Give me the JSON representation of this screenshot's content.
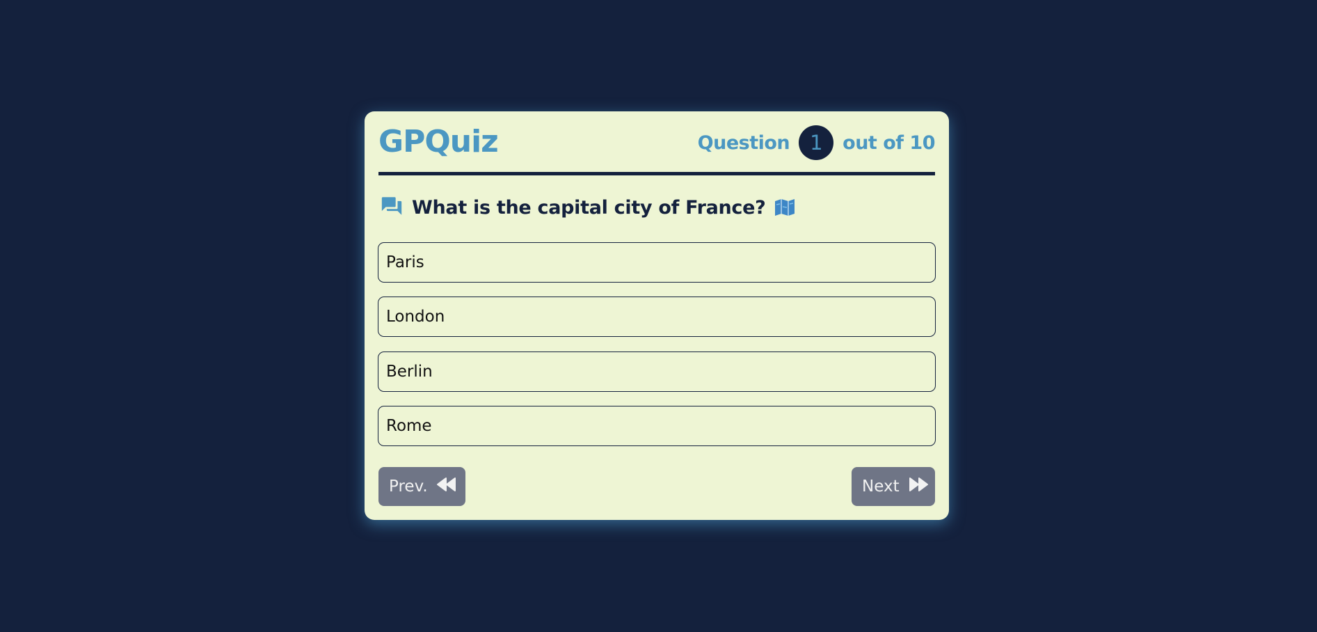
{
  "app": {
    "logo": "GPQuiz"
  },
  "counter": {
    "prefix": "Question",
    "current": "1",
    "suffix": "out of 10"
  },
  "question": {
    "icon": "chat-bubbles-icon",
    "text": "What is the capital city of France?",
    "emoji_icon": "map-icon"
  },
  "options": [
    {
      "label": "Paris"
    },
    {
      "label": "London"
    },
    {
      "label": "Berlin"
    },
    {
      "label": "Rome"
    }
  ],
  "nav": {
    "prev_label": "Prev.",
    "prev_icon": "rewind-icon",
    "next_label": "Next",
    "next_icon": "fast-forward-icon"
  },
  "colors": {
    "background": "#14213d",
    "card": "#eef5d4",
    "accent": "#4b97c2",
    "button": "#6f7586"
  }
}
